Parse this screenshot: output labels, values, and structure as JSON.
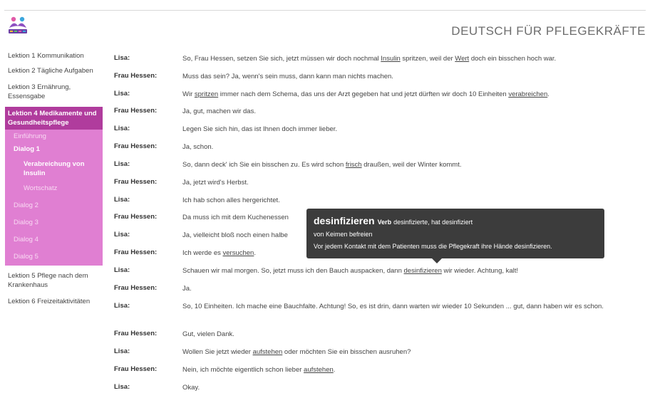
{
  "header": {
    "title": "DEUTSCH FÜR PFLEGEKRÄFTE",
    "logo_icon": "people-logo-icon"
  },
  "sidebar": {
    "lesson1": "Lektion 1 Kommunikation",
    "lesson2": "Lektion 2 Tägliche Aufgaben",
    "lesson3": "Lektion 3 Ernährung, Essensgabe",
    "lesson4": "Lektion 4 Medikamente und Gesundheitspflege",
    "lesson4_items": {
      "einfuehrung": "Einführung",
      "dialog1": "Dialog 1",
      "verabreichung": "Verabreichung von Insulin",
      "wortschatz": "Wortschatz",
      "dialog2": "Dialog 2",
      "dialog3": "Dialog 3",
      "dialog4": "Dialog 4",
      "dialog5": "Dialog 5"
    },
    "lesson5": "Lektion 5 Pflege nach dem Krankenhaus",
    "lesson6": "Lektion 6 Freizeitaktivitäten"
  },
  "dialog": {
    "rows": [
      {
        "speaker": "Lisa:",
        "a": "So, Frau Hessen, setzen Sie sich, jetzt müssen wir doch nochmal ",
        "w1": "Insulin",
        "b": " spritzen, weil der ",
        "w2": "Wert",
        "c": " doch ein bisschen hoch war."
      },
      {
        "speaker": "Frau Hessen:",
        "a": "Muss das sein? Ja, wenn's sein muss, dann kann man nichts machen."
      },
      {
        "speaker": "Lisa:",
        "a": "Wir ",
        "w1": "spritzen",
        "b": " immer nach dem Schema, das uns der Arzt gegeben hat und jetzt dürften wir doch 10 Einheiten ",
        "w2": "verabreichen",
        "c": "."
      },
      {
        "speaker": "Frau Hessen:",
        "a": "Ja, gut, machen wir das."
      },
      {
        "speaker": "Lisa:",
        "a": "Legen Sie sich hin, das ist Ihnen doch immer lieber."
      },
      {
        "speaker": "Frau Hessen:",
        "a": "Ja, schon."
      },
      {
        "speaker": "Lisa:",
        "a": "So, dann deck' ich Sie ein bisschen zu. Es wird schon ",
        "w1": "frisch",
        "b": " draußen, weil der Winter kommt."
      },
      {
        "speaker": "Frau Hessen:",
        "a": "Ja, jetzt wird's Herbst."
      },
      {
        "speaker": "Lisa:",
        "a": "Ich hab schon alles hergerichtet."
      },
      {
        "speaker": "Frau Hessen:",
        "a": "Da muss ich mit dem Kuchenessen"
      },
      {
        "speaker": "Lisa:",
        "a": "Ja, vielleicht bloß noch einen halbe"
      },
      {
        "speaker": "Frau Hessen:",
        "a": "Ich werde es ",
        "w1": "versuchen",
        "b": "."
      },
      {
        "speaker": "Lisa:",
        "a": "Schauen wir mal morgen. So, jetzt muss ich den Bauch auspacken, dann ",
        "w1": "desinfizieren",
        "b": " wir wieder. Achtung, kalt!"
      },
      {
        "speaker": "Frau Hessen:",
        "a": "Ja."
      },
      {
        "speaker": "Lisa:",
        "a": "So, 10 Einheiten. Ich mache eine Bauchfalte. Achtung! So, es ist drin, dann warten wir wieder 10 Sekunden ... gut, dann haben wir es schon."
      },
      {
        "speaker": "Frau Hessen:",
        "a": "Gut, vielen Dank."
      },
      {
        "speaker": "Lisa:",
        "a": "Wollen Sie jetzt wieder ",
        "w1": "aufstehen",
        "b": " oder möchten Sie ein bisschen ausruhen?"
      },
      {
        "speaker": "Frau Hessen:",
        "a": "Nein, ich möchte eigentlich schon lieber ",
        "w1": "aufstehen",
        "b": "."
      },
      {
        "speaker": "Lisa:",
        "a": "Okay."
      }
    ]
  },
  "tooltip": {
    "word": "desinfizieren",
    "pos": "Verb",
    "forms": "desinfizierte, hat desinfiziert",
    "definition": "von Keimen befreien",
    "example": "Vor jedem Kontakt mit dem Patienten muss die Pflegekraft ihre Hände desinfizieren."
  }
}
